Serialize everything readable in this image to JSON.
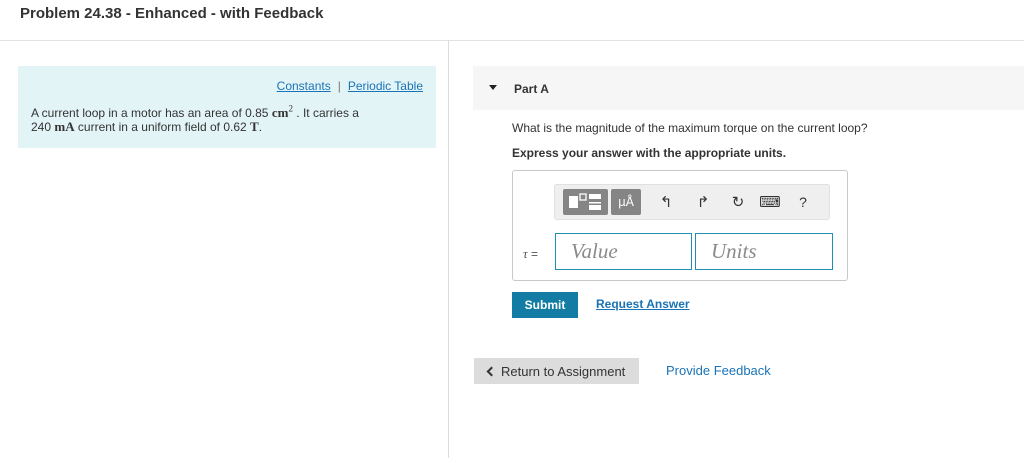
{
  "header": {
    "title": "Problem 24.38 - Enhanced - with Feedback"
  },
  "problem": {
    "links": {
      "constants": "Constants",
      "separator": "|",
      "periodic_table": "Periodic Table"
    },
    "text": {
      "part1": "A current loop in a motor has an area of 0.85 ",
      "area_unit": "cm",
      "area_exp": "2",
      "part2": " . It carries a",
      "current_value": "240 ",
      "current_unit": "mA",
      "part3": " current in a uniform field of 0.62 ",
      "field_unit": "T",
      "part4": "."
    }
  },
  "part_a": {
    "label": "Part A",
    "question": "What is the magnitude of the maximum torque on the current loop?",
    "instruction": "Express your answer with the appropriate units.",
    "toolbar": {
      "units_button": "μÅ",
      "undo_glyph": "↰",
      "redo_glyph": "↱",
      "reset_glyph": "↻",
      "keyboard_glyph": "⌨",
      "help_label": "?"
    },
    "answer": {
      "symbol": "τ",
      "equals": " =",
      "value_placeholder": "Value",
      "units_placeholder": "Units"
    },
    "submit_label": "Submit",
    "request_answer_label": "Request Answer"
  },
  "footer": {
    "return_label": "Return to Assignment",
    "feedback_label": "Provide Feedback"
  }
}
